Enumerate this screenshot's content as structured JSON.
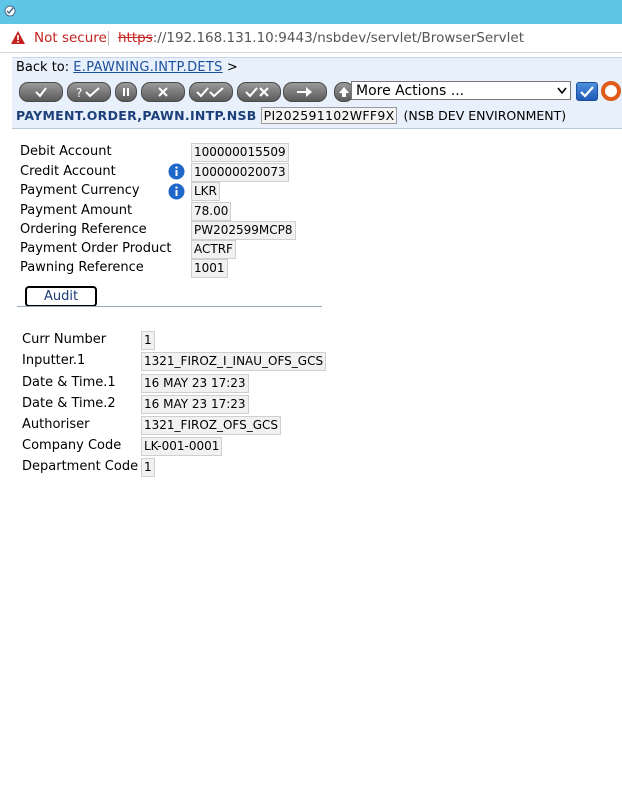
{
  "browser": {
    "security_label": "Not secure",
    "url_protocol": "https",
    "url_rest": "://192.168.131.10:9443/nsbdev/servlet/BrowserServlet"
  },
  "header": {
    "back_to_label": "Back to:",
    "back_to_link": "E.PAWNING.INTP.DETS",
    "back_to_arrow": ">",
    "more_actions": "More Actions ...",
    "application": "PAYMENT.ORDER,PAWN.INTP.NSB",
    "record_id": "PI202591102WFF9X",
    "environment": "(NSB DEV ENVIRONMENT)"
  },
  "toolbar_icons": [
    "commit-icon",
    "validate-icon",
    "hold-icon",
    "delete-icon",
    "authorise-icon",
    "reverse-icon",
    "next-icon",
    "upload-icon"
  ],
  "fields": [
    {
      "label": "Debit Account",
      "value": "100000015509",
      "info": false
    },
    {
      "label": "Credit Account",
      "value": "100000020073",
      "info": true
    },
    {
      "label": "Payment Currency",
      "value": "LKR",
      "info": true
    },
    {
      "label": "Payment Amount",
      "value": "78.00",
      "info": false
    },
    {
      "label": "Ordering Reference",
      "value": "PW202599MCP8",
      "info": false
    },
    {
      "label": "Payment Order Product",
      "value": "ACTRF",
      "info": false
    },
    {
      "label": "Pawning Reference",
      "value": "1001",
      "info": false
    }
  ],
  "tabs": {
    "audit": "Audit"
  },
  "audit": [
    {
      "label": "Curr Number",
      "value": "1"
    },
    {
      "label": "Inputter.1",
      "value": "1321_FIROZ_I_INAU_OFS_GCS"
    },
    {
      "label": "Date & Time.1",
      "value": "16 MAY 23 17:23"
    },
    {
      "label": "Date & Time.2",
      "value": "16 MAY 23 17:23"
    },
    {
      "label": "Authoriser",
      "value": "1321_FIROZ_OFS_GCS"
    },
    {
      "label": "Company Code",
      "value": "LK-001-0001"
    },
    {
      "label": "Department Code",
      "value": "1"
    }
  ]
}
